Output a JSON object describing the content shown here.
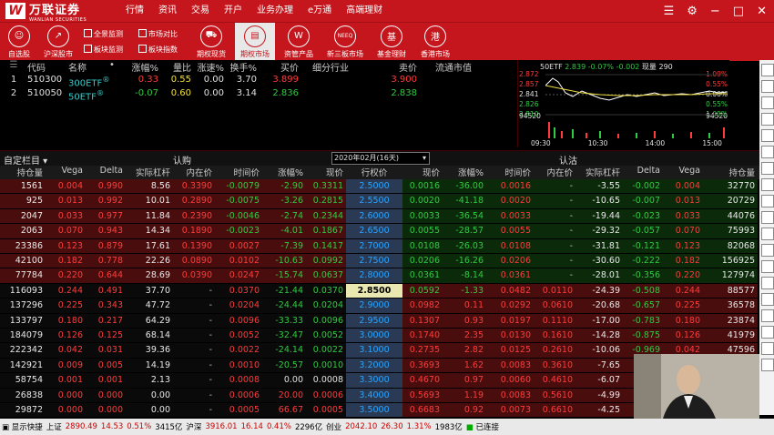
{
  "app": {
    "logo_text": "万联证券",
    "logo_sub": "WANLIAN SECURITIES"
  },
  "topmenu": [
    "行情",
    "资讯",
    "交易",
    "开户",
    "业务办理",
    "e万通",
    "高端理财"
  ],
  "toolbar": {
    "buttons": [
      "自选股",
      "沪深股市",
      "期权现货",
      "期权市场",
      "资管产品",
      "新三板市场",
      "基金理财",
      "香港市场"
    ],
    "mini": [
      "全景监测",
      "板块监测",
      "市场对比",
      "板块指数"
    ]
  },
  "watchlist": {
    "headers": [
      "代码",
      "名称",
      "•",
      "涨幅%",
      "量比",
      "涨速%",
      "换手%",
      "买价",
      "细分行业",
      "卖价",
      "流通市值"
    ],
    "rows": [
      {
        "idx": "1",
        "code": "510300",
        "name": "300ETF",
        "chg": "0.33",
        "vr": "0.55",
        "spd": "0.00",
        "turn": "3.70",
        "bid": "3.899",
        "ask": "3.900"
      },
      {
        "idx": "2",
        "code": "510050",
        "name": "50ETF",
        "chg": "-0.07",
        "vr": "0.60",
        "spd": "0.00",
        "turn": "3.14",
        "bid": "2.836",
        "ask": "2.838"
      }
    ]
  },
  "minichart": {
    "title": "50ETF",
    "price": "2.839",
    "chg": "-0.07%",
    "chg2": "-0.002",
    "vol": "现量 290",
    "yleft": [
      "2.872",
      "2.857",
      "2.841",
      "2.826",
      "2.810"
    ],
    "yright": [
      "1.09%",
      "0.55%",
      "0.00%",
      "0.55%",
      "1.09%"
    ],
    "vol_labels": [
      "94520",
      "94520"
    ],
    "x": [
      "09:30",
      "10:30",
      "14:00",
      "15:00"
    ]
  },
  "section": {
    "left": "自定栏目",
    "call": "认购",
    "month": "2020年02月(16天)",
    "put": "认沽"
  },
  "table": {
    "headers": [
      "持仓量",
      "Vega",
      "Delta",
      "实际杠杆",
      "内在价",
      "时间价",
      "涨幅%",
      "现价",
      "行权价",
      "现价",
      "涨幅%",
      "时间价",
      "内在价",
      "实际杠杆",
      "Delta",
      "Vega",
      "持仓量"
    ],
    "rows": [
      [
        "1561",
        "0.004",
        "0.990",
        "8.56",
        "0.3390",
        "-0.0079",
        "-2.90",
        "0.3311",
        "2.5000",
        "0.0016",
        "-36.00",
        "0.0016",
        "-",
        "-3.55",
        "-0.002",
        "0.004",
        "32770"
      ],
      [
        "925",
        "0.013",
        "0.992",
        "10.01",
        "0.2890",
        "-0.0075",
        "-3.26",
        "0.2815",
        "2.5500",
        "0.0020",
        "-41.18",
        "0.0020",
        "-",
        "-10.65",
        "-0.007",
        "0.013",
        "20729"
      ],
      [
        "2047",
        "0.033",
        "0.977",
        "11.84",
        "0.2390",
        "-0.0046",
        "-2.74",
        "0.2344",
        "2.6000",
        "0.0033",
        "-36.54",
        "0.0033",
        "-",
        "-19.44",
        "-0.023",
        "0.033",
        "44076"
      ],
      [
        "2063",
        "0.070",
        "0.943",
        "14.34",
        "0.1890",
        "-0.0023",
        "-4.01",
        "0.1867",
        "2.6500",
        "0.0055",
        "-28.57",
        "0.0055",
        "-",
        "-29.32",
        "-0.057",
        "0.070",
        "75993"
      ],
      [
        "23386",
        "0.123",
        "0.879",
        "17.61",
        "0.1390",
        "0.0027",
        "-7.39",
        "0.1417",
        "2.7000",
        "0.0108",
        "-26.03",
        "0.0108",
        "-",
        "-31.81",
        "-0.121",
        "0.123",
        "82068"
      ],
      [
        "42100",
        "0.182",
        "0.778",
        "22.26",
        "0.0890",
        "0.0102",
        "-10.63",
        "0.0992",
        "2.7500",
        "0.0206",
        "-16.26",
        "0.0206",
        "-",
        "-30.60",
        "-0.222",
        "0.182",
        "156925"
      ],
      [
        "77784",
        "0.220",
        "0.644",
        "28.69",
        "0.0390",
        "0.0247",
        "-15.74",
        "0.0637",
        "2.8000",
        "0.0361",
        "-8.14",
        "0.0361",
        "-",
        "-28.01",
        "-0.356",
        "0.220",
        "127974"
      ],
      [
        "116093",
        "0.244",
        "0.491",
        "37.70",
        "-",
        "0.0370",
        "-21.44",
        "0.0370",
        "2.8500",
        "0.0592",
        "-1.33",
        "0.0482",
        "0.0110",
        "-24.39",
        "-0.508",
        "0.244",
        "88577"
      ],
      [
        "137296",
        "0.225",
        "0.343",
        "47.72",
        "-",
        "0.0204",
        "-24.44",
        "0.0204",
        "2.9000",
        "0.0982",
        "0.11",
        "0.0292",
        "0.0610",
        "-20.68",
        "-0.657",
        "0.225",
        "36578"
      ],
      [
        "133797",
        "0.180",
        "0.217",
        "64.29",
        "-",
        "0.0096",
        "-33.33",
        "0.0096",
        "2.9500",
        "0.1307",
        "0.93",
        "0.0197",
        "0.1110",
        "-17.00",
        "-0.783",
        "0.180",
        "23874"
      ],
      [
        "184079",
        "0.126",
        "0.125",
        "68.14",
        "-",
        "0.0052",
        "-32.47",
        "0.0052",
        "3.0000",
        "0.1740",
        "2.35",
        "0.0130",
        "0.1610",
        "-14.28",
        "-0.875",
        "0.126",
        "41979"
      ],
      [
        "222342",
        "0.042",
        "0.031",
        "39.36",
        "-",
        "0.0022",
        "-24.14",
        "0.0022",
        "3.1000",
        "0.2735",
        "2.82",
        "0.0125",
        "0.2610",
        "-10.06",
        "-0.969",
        "0.042",
        "47596"
      ],
      [
        "142921",
        "0.009",
        "0.005",
        "14.19",
        "-",
        "0.0010",
        "-20.57",
        "0.0010",
        "3.2000",
        "0.3693",
        "1.62",
        "0.0083",
        "0.3610",
        "-7.65",
        "",
        "",
        ""
      ],
      [
        "58754",
        "0.001",
        "0.001",
        "2.13",
        "-",
        "0.0008",
        "0.00",
        "0.0008",
        "3.3000",
        "0.4670",
        "0.97",
        "0.0060",
        "0.4610",
        "-6.07",
        "",
        "",
        ""
      ],
      [
        "26838",
        "0.000",
        "0.000",
        "0.00",
        "-",
        "0.0006",
        "20.00",
        "0.0006",
        "3.4000",
        "0.5693",
        "1.19",
        "0.0083",
        "0.5610",
        "-4.99",
        "",
        "",
        ""
      ],
      [
        "29872",
        "0.000",
        "0.000",
        "0.00",
        "-",
        "0.0005",
        "66.67",
        "0.0005",
        "3.5000",
        "0.6683",
        "0.92",
        "0.0073",
        "0.6610",
        "-4.25",
        "",
        "",
        ""
      ]
    ]
  },
  "statusbar": {
    "quick": "显示快捷",
    "sh_label": "上证",
    "sh": "2890.49",
    "sh_chg": "14.53",
    "sh_pct": "0.51%",
    "sh_amt": "3415亿",
    "hs_label": "沪深",
    "hs": "3916.01",
    "hs_chg": "16.14",
    "hs_pct": "0.41%",
    "hs_amt": "2296亿",
    "cy_label": "创业",
    "cy": "2042.10",
    "cy_chg": "26.30",
    "cy_pct": "1.31%",
    "cy_amt": "1983亿",
    "conn": "已连接"
  }
}
